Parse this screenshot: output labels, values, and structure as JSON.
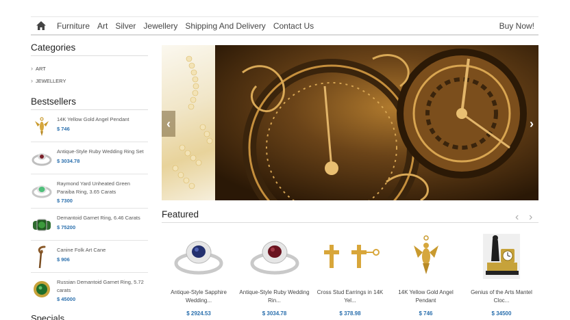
{
  "nav": {
    "items": [
      "Furniture",
      "Art",
      "Silver",
      "Jewellery",
      "Shipping And Delivery",
      "Contact Us"
    ],
    "buy": "Buy Now!"
  },
  "sidebar": {
    "categories_title": "Categories",
    "categories": [
      "ART",
      "JEWELLERY"
    ],
    "bestsellers_title": "Bestsellers",
    "bestsellers": [
      {
        "name": "14K Yellow Gold Angel Pendant",
        "price": "$ 746"
      },
      {
        "name": "Antique-Style Ruby Wedding Ring Set",
        "price": "$ 3034.78"
      },
      {
        "name": "Raymond Yard Unheated Green Paraiba Ring, 3.65 Carats",
        "price": "$ 7300"
      },
      {
        "name": "Demantoid Garnet Ring, 6.46 Carats",
        "price": "$ 75200"
      },
      {
        "name": "Canine Folk Art Cane",
        "price": "$ 906"
      },
      {
        "name": "Russian Demantoid Garnet Ring, 5.72 carats",
        "price": "$ 45000"
      }
    ],
    "specials_title": "Specials"
  },
  "featured": {
    "title": "Featured",
    "products": [
      {
        "name": "Antique-Style Sapphire Wedding...",
        "price": "$ 2924.53"
      },
      {
        "name": "Antique-Style Ruby Wedding Rin...",
        "price": "$ 3034.78"
      },
      {
        "name": "Cross Stud Earrings in 14K Yel...",
        "price": "$ 378.98"
      },
      {
        "name": "14K Yellow Gold Angel Pendant",
        "price": "$ 746"
      },
      {
        "name": "Genius of the Arts Mantel Cloc...",
        "price": "$ 34500"
      }
    ]
  },
  "colors": {
    "price": "#2a6fad",
    "gold": "#c99a2e"
  }
}
